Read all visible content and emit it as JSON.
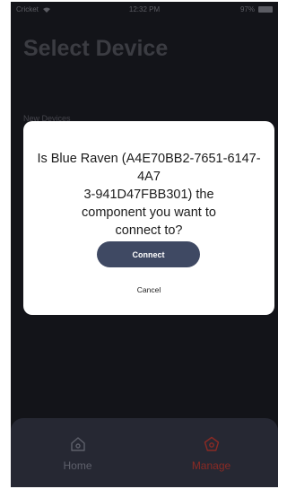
{
  "status_bar": {
    "carrier": "Cricket",
    "time": "12:32 PM",
    "battery": "97%"
  },
  "screen": {
    "title": "Select Device",
    "section_label": "New Devices"
  },
  "dialog": {
    "message": "Is Blue Raven (A4E70BB2-7651-6147-4A73-941D47FBB301) the component you want to connect to?",
    "message_lines": [
      "Is Blue Raven (A4E70BB2-7651-6147-4A7",
      "3-941D47FBB301) the",
      "component you want to",
      "connect to?"
    ],
    "connect_label": "Connect",
    "cancel_label": "Cancel"
  },
  "tab_bar": {
    "tabs": [
      {
        "label": "Home",
        "icon": "home-icon",
        "active": false
      },
      {
        "label": "Manage",
        "icon": "manage-pentagon-icon",
        "active": true
      }
    ]
  },
  "colors": {
    "background": "#1e1f27",
    "tab_bar": "#262833",
    "connect_button": "#3f4963",
    "active_tab": "#8a2a24"
  }
}
